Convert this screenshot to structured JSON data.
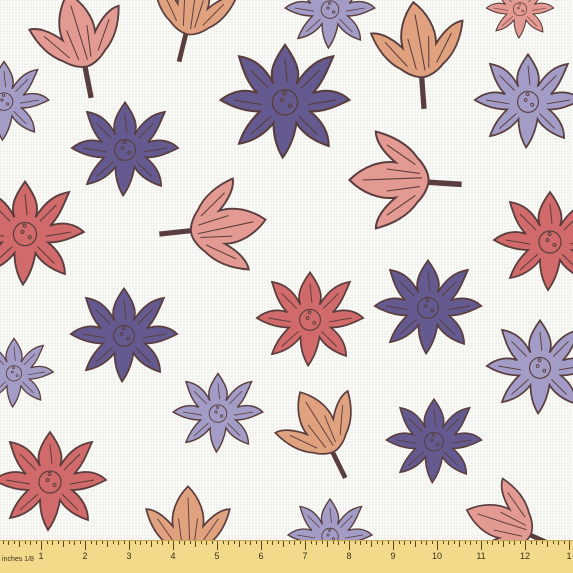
{
  "image": {
    "kind": "fabric swatch",
    "motif": "lotus flowers",
    "background_color": "#fbfbf8",
    "palette": {
      "indigo": "#655a8f",
      "lavender": "#a39cc7",
      "coral": "#d16a6a",
      "pink": "#e29a92",
      "peach": "#e0a17f",
      "outline": "#5a3d3d"
    }
  },
  "ruler": {
    "label": "inches 1/8",
    "numbers": [
      "1",
      "2",
      "3",
      "4",
      "5",
      "6",
      "7",
      "8",
      "9",
      "10",
      "11",
      "12",
      "1"
    ],
    "color": "#f3d98a"
  }
}
